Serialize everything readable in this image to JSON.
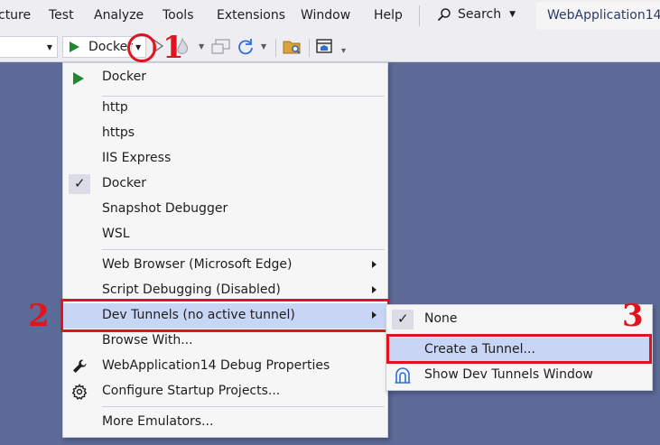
{
  "menubar": {
    "items": [
      "cture",
      "Test",
      "Analyze",
      "Tools",
      "Extensions",
      "Window",
      "Help"
    ],
    "search_label": "Search",
    "app_title": "WebApplication14"
  },
  "toolbar": {
    "run_label": "Docker"
  },
  "annotations": {
    "one": "1",
    "two": "2",
    "three": "3",
    "color": "#e1141e"
  },
  "menu": {
    "items": [
      {
        "label": "Docker",
        "icon": "play-icon"
      },
      {
        "label": "http"
      },
      {
        "label": "https"
      },
      {
        "label": "IIS Express"
      },
      {
        "label": "Docker",
        "checked": true
      },
      {
        "label": "Snapshot Debugger"
      },
      {
        "label": "WSL"
      },
      {
        "label": "Web Browser (Microsoft Edge)",
        "submenu": true
      },
      {
        "label": "Script Debugging (Disabled)",
        "submenu": true
      },
      {
        "label": "Dev Tunnels (no active tunnel)",
        "submenu": true,
        "highlighted": true
      },
      {
        "label": "Browse With..."
      },
      {
        "label": "WebApplication14 Debug Properties",
        "icon": "wrench-icon"
      },
      {
        "label": "Configure Startup Projects...",
        "icon": "gear-icon"
      },
      {
        "label": "More Emulators..."
      }
    ]
  },
  "submenu": {
    "items": [
      {
        "label": "None",
        "checked": true
      },
      {
        "label": "Create a Tunnel...",
        "highlighted": true
      },
      {
        "label": "Show Dev Tunnels Window",
        "icon": "dev-tunnels-icon"
      }
    ]
  },
  "colors": {
    "background": "#5d6b99",
    "chrome": "#eeeef2",
    "highlight": "#c9d5f5",
    "run_green": "#1e8a2e",
    "annotation_red": "#e1141e"
  }
}
